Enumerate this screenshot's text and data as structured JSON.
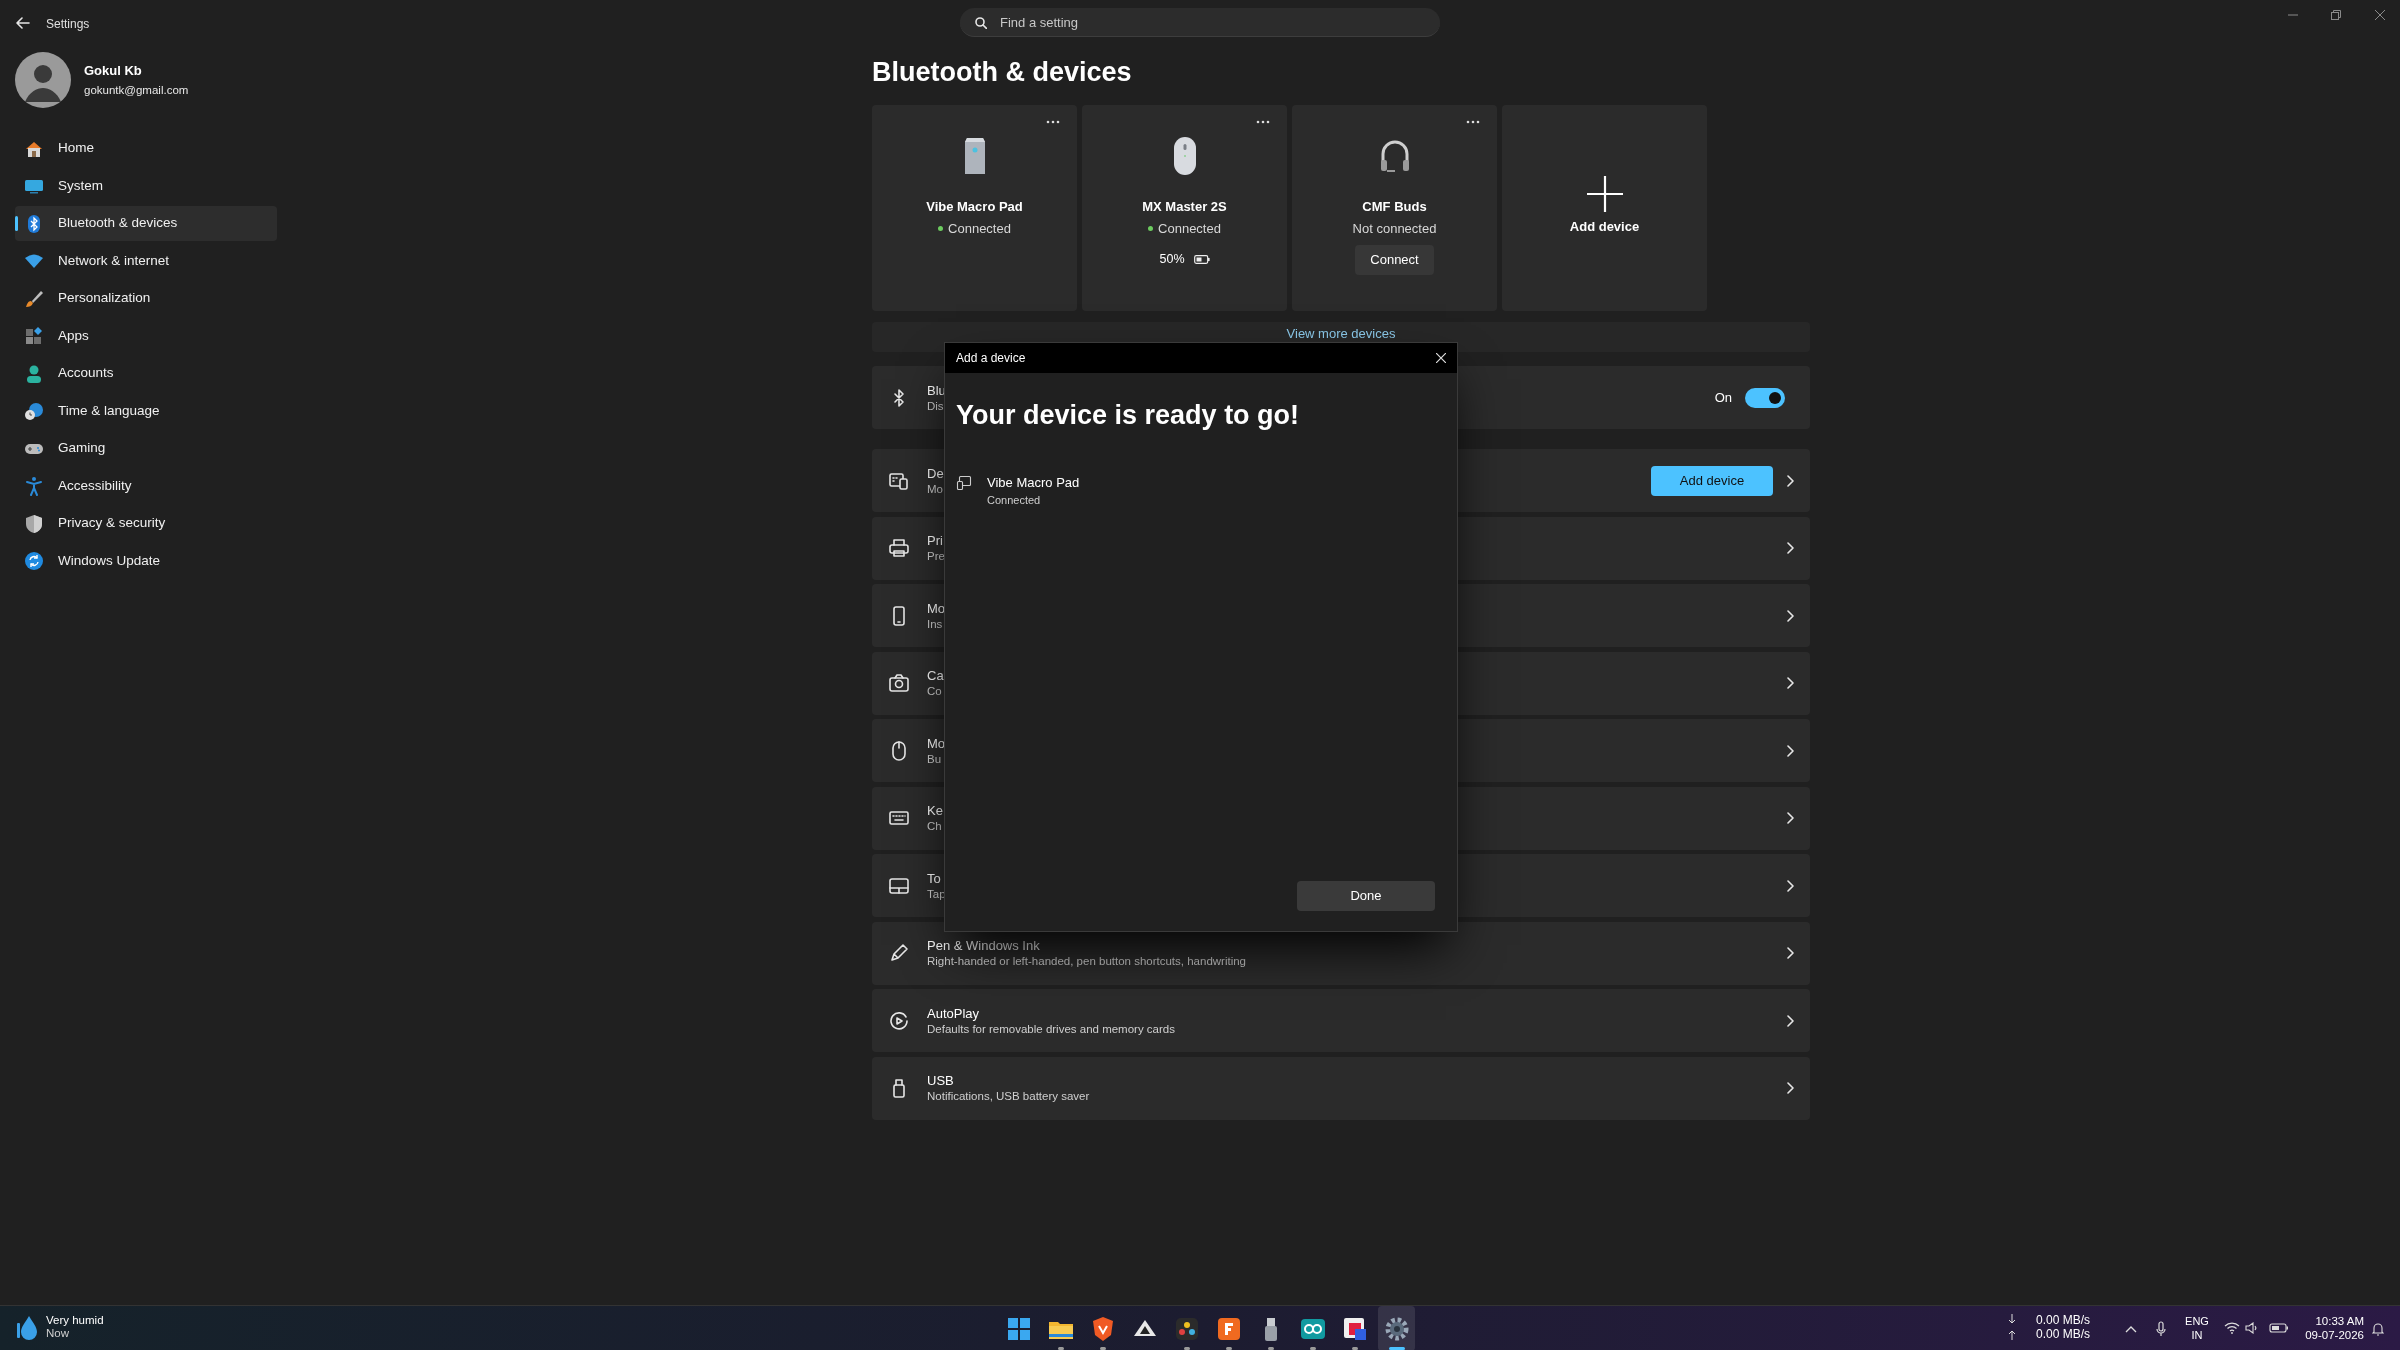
{
  "window": {
    "title": "Settings"
  },
  "search": {
    "placeholder": "Find a setting"
  },
  "user": {
    "name": "Gokul Kb",
    "email": "gokuntk@gmail.com"
  },
  "sidebar": {
    "items": [
      {
        "label": "Home",
        "selected": false
      },
      {
        "label": "System",
        "selected": false
      },
      {
        "label": "Bluetooth & devices",
        "selected": true
      },
      {
        "label": "Network & internet",
        "selected": false
      },
      {
        "label": "Personalization",
        "selected": false
      },
      {
        "label": "Apps",
        "selected": false
      },
      {
        "label": "Accounts",
        "selected": false
      },
      {
        "label": "Time & language",
        "selected": false
      },
      {
        "label": "Gaming",
        "selected": false
      },
      {
        "label": "Accessibility",
        "selected": false
      },
      {
        "label": "Privacy & security",
        "selected": false
      },
      {
        "label": "Windows Update",
        "selected": false
      }
    ]
  },
  "page_title": "Bluetooth & devices",
  "device_cards": [
    {
      "name": "Vibe Macro Pad",
      "status": "Connected",
      "connected": true
    },
    {
      "name": "MX Master 2S",
      "status": "Connected",
      "connected": true,
      "battery": "50%"
    },
    {
      "name": "CMF Buds",
      "status": "Not connected",
      "connected": false,
      "action": "Connect"
    }
  ],
  "add_card": {
    "label": "Add device"
  },
  "view_more": "View more devices",
  "rows": [
    {
      "kind": "toggle",
      "title": "Blu",
      "subtitle": "Dis",
      "toggle_label": "On",
      "on": true
    },
    {
      "kind": "button",
      "title": "De",
      "subtitle": "Mo",
      "button": "Add device"
    },
    {
      "kind": "link",
      "title": "Pri",
      "subtitle": "Pre"
    },
    {
      "kind": "link",
      "title": "Mo",
      "subtitle": "Ins"
    },
    {
      "kind": "link",
      "title": "Ca",
      "subtitle": "Co"
    },
    {
      "kind": "link",
      "title": "Mo",
      "subtitle": "Bu"
    },
    {
      "kind": "link",
      "title": "Ke",
      "subtitle": "Ch"
    },
    {
      "kind": "link",
      "title": "To",
      "subtitle": "Tap"
    },
    {
      "kind": "link",
      "title": "Pen & Windows Ink",
      "subtitle": "Right-handed or left-handed, pen button shortcuts, handwriting"
    },
    {
      "kind": "link",
      "title": "AutoPlay",
      "subtitle": "Defaults for removable drives and memory cards"
    },
    {
      "kind": "link",
      "title": "USB",
      "subtitle": "Notifications, USB battery saver"
    }
  ],
  "dialog": {
    "title": "Add a device",
    "heading": "Your device is ready to go!",
    "device": {
      "name": "Vibe Macro Pad",
      "status": "Connected"
    },
    "button": "Done"
  },
  "taskbar": {
    "weather": {
      "condition": "Very humid",
      "time": "Now"
    },
    "apps": [
      {
        "running": false,
        "selected": false
      },
      {
        "running": true,
        "selected": false
      },
      {
        "running": true,
        "selected": false
      },
      {
        "running": false,
        "selected": false
      },
      {
        "running": true,
        "selected": false
      },
      {
        "running": true,
        "selected": false
      },
      {
        "running": true,
        "selected": false
      },
      {
        "running": true,
        "selected": false
      },
      {
        "running": true,
        "selected": false
      },
      {
        "running": true,
        "selected": true
      }
    ],
    "net_speed": {
      "down": "0.00 MB/s",
      "up": "0.00 MB/s"
    },
    "language": {
      "code": "ENG",
      "region": "IN"
    },
    "clock": {
      "time": "10:33 AM",
      "date": "09-07-2026"
    }
  }
}
